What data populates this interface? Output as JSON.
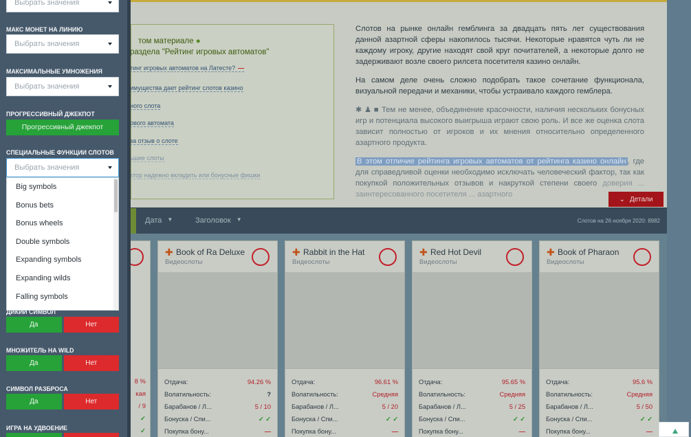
{
  "sidebar": {
    "top_select_placeholder": "Выбрать значения",
    "max_coins_label": "Макс монет на линию",
    "max_coins_placeholder": "Выбрать значения",
    "max_mult_label": "Максимальные умножения",
    "max_mult_placeholder": "Выбрать значения",
    "progressive_label": "Прогрессивный джекпот",
    "progressive_button": "Прогрессивный джекпот",
    "special_label": "Специальные функции слотов",
    "special_placeholder": "Выбрать значения",
    "special_options": [
      "Big symbols",
      "Bonus bets",
      "Bonus wheels",
      "Double symbols",
      "Expanding symbols",
      "Expanding wilds",
      "Falling symbols"
    ],
    "wild_label": "Дикий символ",
    "wild_mult_label": "Множитель на wild",
    "scatter_label": "Символ разброса",
    "double_game_label": "Игра на удвоение",
    "yes_label": "Да",
    "no_label": "Нет"
  },
  "article": {
    "left_title_1": "том материале",
    "left_title_2": "раздела \"Рейтинг игровых автоматов\"",
    "links": [
      "тинг игровых автоматов на Латесте?",
      "имущества дает рейтинг слотов казино",
      "ного слота",
      "ового автомата",
      "за отзыв о слоте",
      "ьшие слоты",
      "ктор надежно вкладить или бонусные фишки"
    ],
    "p1": "Слотов на рынке онлайн гемблинга за двадцать пять лет существования данной азартной сферы накопилось тысячи. Некоторые нравятся чуть ли не каждому игроку, другие находят свой круг почитателей, а некоторые долго не задерживают возле своего рилсета посетителя казино онлайн.",
    "p2": "На самом деле очень сложно подобрать такое сочетание функционала, визуальной передачи и механики, чтобы устраивало каждого гемблера.",
    "p3": "Тем не менее, объединение красочности, наличия нескольких бонусных игр и потенциала высокого выигрыша играют свою роль. И все же оценка слота зависит полностью от игроков и их мнения относительно определенного азартного продукта.",
    "p4_highlight": "В этом отличие рейтинга игровых автоматов от рейтинга казино онлайн",
    "p4_rest": ", где для справедливой оценки необходимо исключать человеческий фактор, так как покупкой положительных отзывов и накруткой степени своего",
    "p4_fade": "доверия ... заинтересованного посетителя ... азартного",
    "details_button": "Детали"
  },
  "sortbar": {
    "date": "Дата",
    "title": "Заголовок",
    "count": "Слотов на 26 ноября 2020: 8982"
  },
  "row_labels": [
    "Отдача:",
    "Волатильность:",
    "Барабанов / Л...",
    "Бонуска / Спи...",
    "Покупка бону..."
  ],
  "partial_card": {
    "values": [
      "8 %",
      "кая",
      "/ 9",
      "✓",
      "✓"
    ]
  },
  "cards": [
    {
      "title": "Book of Ra Deluxe",
      "category": "Видеослоты",
      "rtp": "94.26 %",
      "volatility": "?",
      "reels": "5 / 10",
      "bonus_free": "✓ ✓",
      "bonus_buy": "—"
    },
    {
      "title": "Rabbit in the Hat",
      "category": "Видеослоты",
      "rtp": "96.61 %",
      "volatility": "Средняя",
      "reels": "5 / 20",
      "bonus_free": "✓ ✓",
      "bonus_buy": "—"
    },
    {
      "title": "Red Hot Devil",
      "category": "Видеослоты",
      "rtp": "95.65 %",
      "volatility": "Средняя",
      "reels": "5 / 25",
      "bonus_free": "✓ ✓",
      "bonus_buy": "—"
    },
    {
      "title": "Book of Pharaon",
      "category": "Видеослоты",
      "rtp": "95.6 %",
      "volatility": "Средняя",
      "reels": "5 / 50",
      "bonus_free": "✓ ✓",
      "bonus_buy": "—"
    }
  ],
  "colors": {
    "accent_green": "#26a239",
    "accent_red": "#dd2a2c",
    "sidebar_bg": "#46596b",
    "details_red": "#a3151a"
  }
}
